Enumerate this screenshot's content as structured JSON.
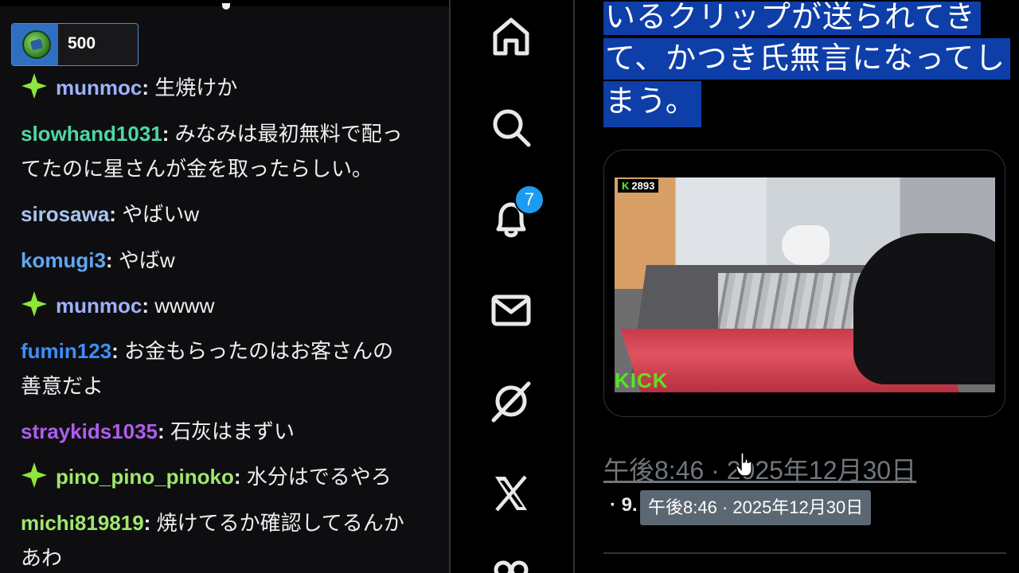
{
  "chat": {
    "points_balance": "500",
    "messages": [
      {
        "badge": "sparkle-badge",
        "user": "munmoc",
        "user_color": "#9eb1ff",
        "separator": ":",
        "lines": [
          "生焼けか"
        ]
      },
      {
        "badge": null,
        "user": "slowhand1031",
        "user_color": "#4fd6a5",
        "separator": ":",
        "lines": [
          "みなみは最初無料で配っ",
          "てたのに星さんが金を取ったらしい。"
        ]
      },
      {
        "badge": null,
        "user": "sirosawa",
        "user_color": "#a8c4f0",
        "separator": ":",
        "lines": [
          "やばいw"
        ]
      },
      {
        "badge": null,
        "user": "komugi3",
        "user_color": "#5fa8f5",
        "separator": ":",
        "lines": [
          "やばw"
        ]
      },
      {
        "badge": "sparkle-badge",
        "user": "munmoc",
        "user_color": "#9eb1ff",
        "separator": ":",
        "lines": [
          "wwww"
        ]
      },
      {
        "badge": null,
        "user": "fumin123",
        "user_color": "#3d8eff",
        "separator": ":",
        "lines": [
          "お金もらったのはお客さんの",
          "善意だよ"
        ]
      },
      {
        "badge": null,
        "user": "straykids1035",
        "user_color": "#b05cf0",
        "separator": ":",
        "lines": [
          "石灰はまずい"
        ]
      },
      {
        "badge": "sparkle-badge",
        "user": "pino_pino_pinoko",
        "user_color": "#9ee86b",
        "separator": ":",
        "lines": [
          "水分はでるやろ"
        ]
      },
      {
        "badge": null,
        "user": "michi819819",
        "user_color": "#9ee86b",
        "separator": ":",
        "lines": [
          "焼けてるか確認してるんか",
          "あわ"
        ]
      }
    ]
  },
  "nav": {
    "items": [
      {
        "name": "home-icon",
        "label": "Home"
      },
      {
        "name": "search-icon",
        "label": "Explore"
      },
      {
        "name": "bell-icon",
        "label": "Notifications"
      },
      {
        "name": "mail-icon",
        "label": "Messages"
      },
      {
        "name": "grok-icon",
        "label": "Grok"
      },
      {
        "name": "x-logo-icon",
        "label": "Premium"
      },
      {
        "name": "people-icon",
        "label": "Communities"
      }
    ],
    "notification_count": "7"
  },
  "tweet": {
    "selected_text_lines": [
      "いるクリップが送られてき",
      "て、かつき氏無言になってし",
      "まう。"
    ],
    "video": {
      "viewer_count": "2893",
      "platform_watermark": "KICK"
    },
    "timestamp": "午後8:46 · 2025年12月30日",
    "stats_prefix": "· 9.",
    "tooltip": "午後8:46 · 2025年12月30日"
  },
  "colors": {
    "accent": "#1d9bf0",
    "selection": "#0e3ea8",
    "chat_bg": "#0e0e10",
    "kick_green": "#53fc18"
  }
}
